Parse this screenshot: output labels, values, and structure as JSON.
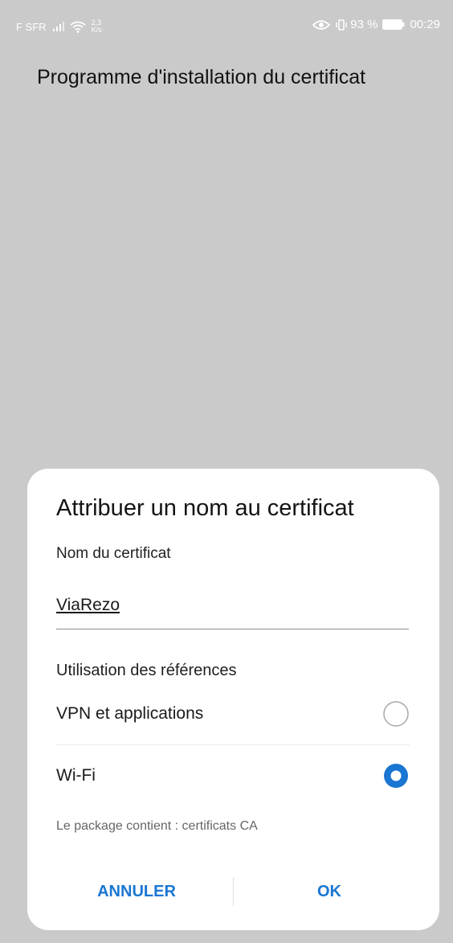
{
  "status_bar": {
    "carrier": "F SFR",
    "net_speed_value": "2,3",
    "net_speed_unit": "K/s",
    "battery_percent": "93 %",
    "time": "00:29",
    "icons": [
      "signal-icon",
      "wifi-icon",
      "eye-icon",
      "vibrate-icon",
      "battery-icon"
    ]
  },
  "app": {
    "title": "Programme d'installation du certificat"
  },
  "dialog": {
    "title": "Attribuer un nom au certificat",
    "name_label": "Nom du certificat",
    "name_value": "ViaRezo",
    "usage_label": "Utilisation des références",
    "options": [
      {
        "label": "VPN et applications",
        "selected": false
      },
      {
        "label": "Wi-Fi",
        "selected": true
      }
    ],
    "package_info": "Le package contient : certificats CA",
    "cancel_label": "ANNULER",
    "ok_label": "OK",
    "accent_color": "#1a76d2"
  }
}
